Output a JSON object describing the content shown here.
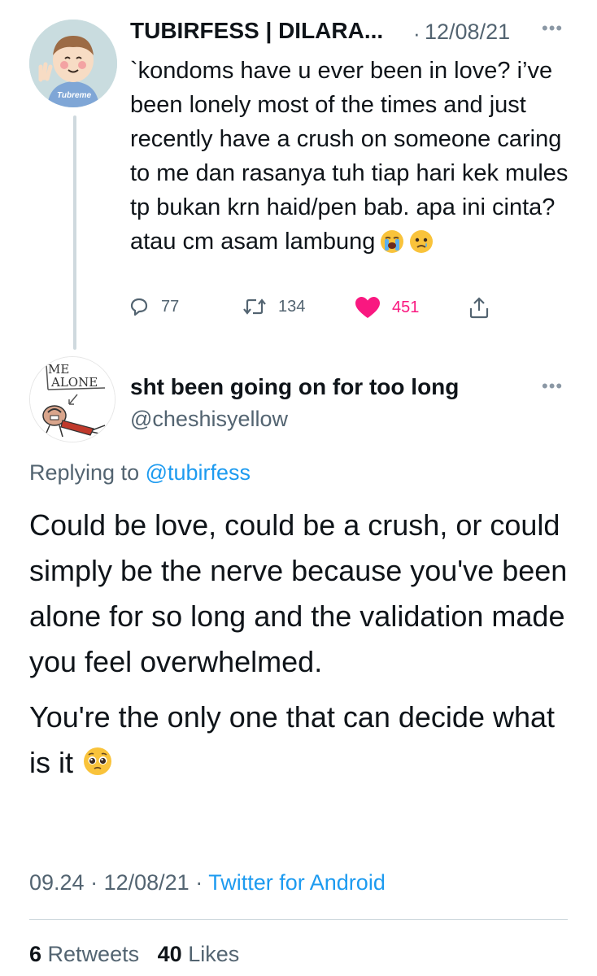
{
  "parent_tweet": {
    "author_name": "TUBIRFESS | DILARA...",
    "date": "12/08/21",
    "avatar_caption": "Tubreme",
    "text": "`kondoms have u ever been in love? i’ve been lonely most of the times and just recently have a crush on someone caring to me dan rasanya tuh tiap hari kek mules tp bukan krn haid/pen bab. apa ini cinta? atau cm asam lambung",
    "emojis": [
      "loudly-crying-face-icon",
      "face-holding-back-tears-icon"
    ],
    "replies": "77",
    "retweets": "134",
    "likes": "451",
    "like_color": "#f91880"
  },
  "reply_tweet": {
    "author_name": "sht been going on for too long",
    "handle": "@cheshisyellow",
    "avatar_text": [
      "ME",
      "ALONE"
    ],
    "replying_prefix": "Replying to",
    "replying_to": "@tubirfess",
    "paragraph1": "Could be love, could be a crush, or could simply be the nerve because you've been alone for so long and the validation made you feel overwhelmed.",
    "paragraph2": "You're the only one that can decide what is it",
    "paragraph2_emoji": "pleading-face-icon",
    "time": "09.24",
    "date": "12/08/21",
    "source": "Twitter for Android",
    "retweet_count": "6",
    "retweet_label": "Retweets",
    "like_count": "40",
    "like_label": "Likes"
  },
  "colors": {
    "link_blue": "#1d9bf0",
    "secondary_text": "#536471",
    "primary_text": "#0f1419"
  }
}
